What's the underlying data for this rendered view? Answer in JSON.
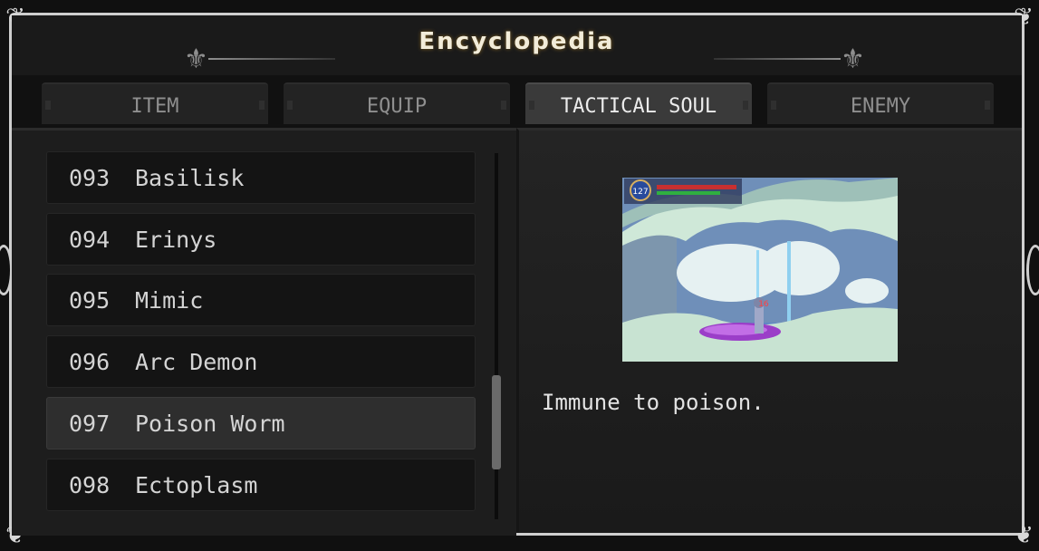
{
  "header": {
    "title": "Encyclopedia"
  },
  "tabs": [
    {
      "label": "ITEM",
      "active": false
    },
    {
      "label": "EQUIP",
      "active": false
    },
    {
      "label": "TACTICAL SOUL",
      "active": true
    },
    {
      "label": "ENEMY",
      "active": false
    }
  ],
  "list": {
    "items": [
      {
        "num": "093",
        "name": "Basilisk",
        "selected": false
      },
      {
        "num": "094",
        "name": "Erinys",
        "selected": false
      },
      {
        "num": "095",
        "name": "Mimic",
        "selected": false
      },
      {
        "num": "096",
        "name": "Arc Demon",
        "selected": false
      },
      {
        "num": "097",
        "name": "Poison Worm",
        "selected": true
      },
      {
        "num": "098",
        "name": "Ectoplasm",
        "selected": false
      }
    ]
  },
  "detail": {
    "description": "Immune to poison.",
    "preview": {
      "hp": "127",
      "damage": "16"
    }
  },
  "colors": {
    "accent": "#f2ecd9",
    "frame": "#cfcfcf",
    "water": "#6e8fb8"
  }
}
